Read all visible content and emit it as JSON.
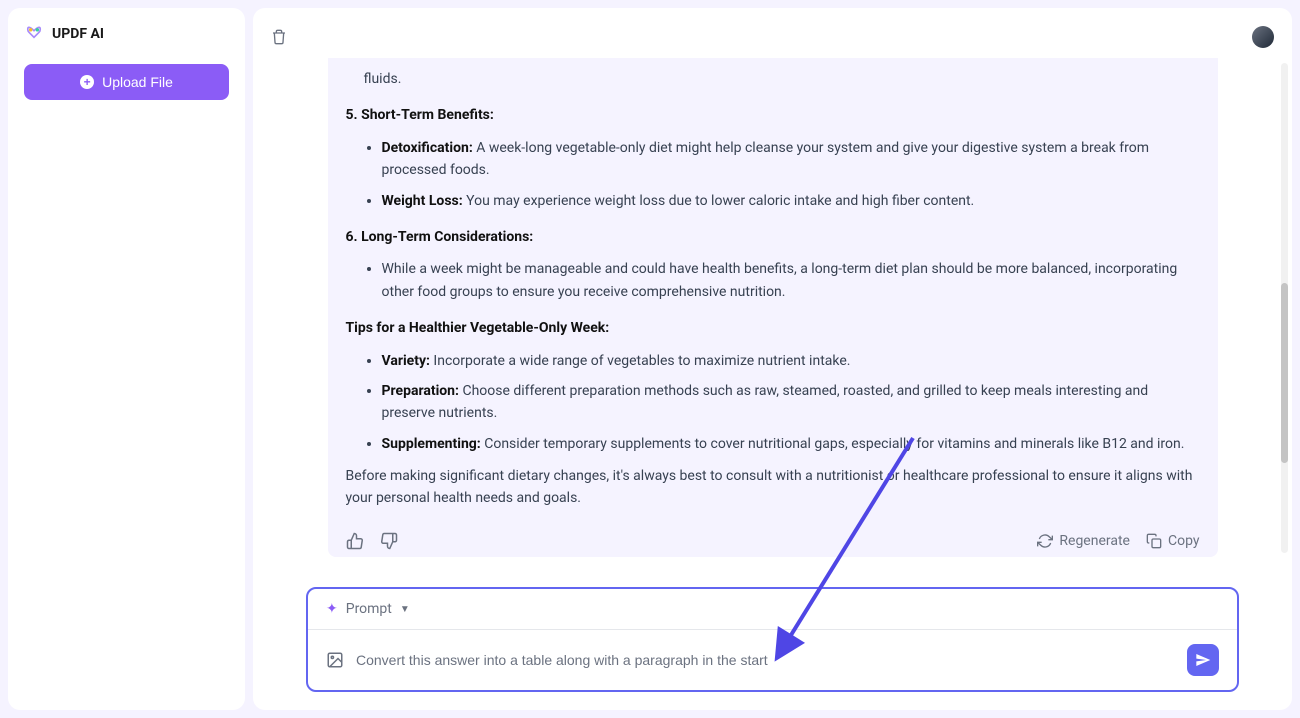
{
  "sidebar": {
    "app_name": "UPDF AI",
    "upload_label": "Upload File"
  },
  "answer": {
    "fluids_trail": "fluids.",
    "section5_heading": "5. Short-Term Benefits:",
    "detox_label": "Detoxification:",
    "detox_text": " A week-long vegetable-only diet might help cleanse your system and give your digestive system a break from processed foods.",
    "weight_label": "Weight Loss:",
    "weight_text": " You may experience weight loss due to lower caloric intake and high fiber content.",
    "section6_heading": "6. Long-Term Considerations:",
    "longterm_text": "While a week might be manageable and could have health benefits, a long-term diet plan should be more balanced, incorporating other food groups to ensure you receive comprehensive nutrition.",
    "tips_heading": "Tips for a Healthier Vegetable-Only Week:",
    "variety_label": "Variety:",
    "variety_text": " Incorporate a wide range of vegetables to maximize nutrient intake.",
    "prep_label": "Preparation:",
    "prep_text": " Choose different preparation methods such as raw, steamed, roasted, and grilled to keep meals interesting and preserve nutrients.",
    "supp_label": "Supplementing:",
    "supp_text": " Consider temporary supplements to cover nutritional gaps, especially for vitamins and minerals like B12 and iron.",
    "closing": "Before making significant dietary changes, it's always best to consult with a nutritionist or healthcare professional to ensure it aligns with your personal health needs and goals."
  },
  "actions": {
    "regenerate": "Regenerate",
    "copy": "Copy"
  },
  "prompt": {
    "label": "Prompt",
    "input_value": "Convert this answer into a table along with a paragraph in the start"
  }
}
